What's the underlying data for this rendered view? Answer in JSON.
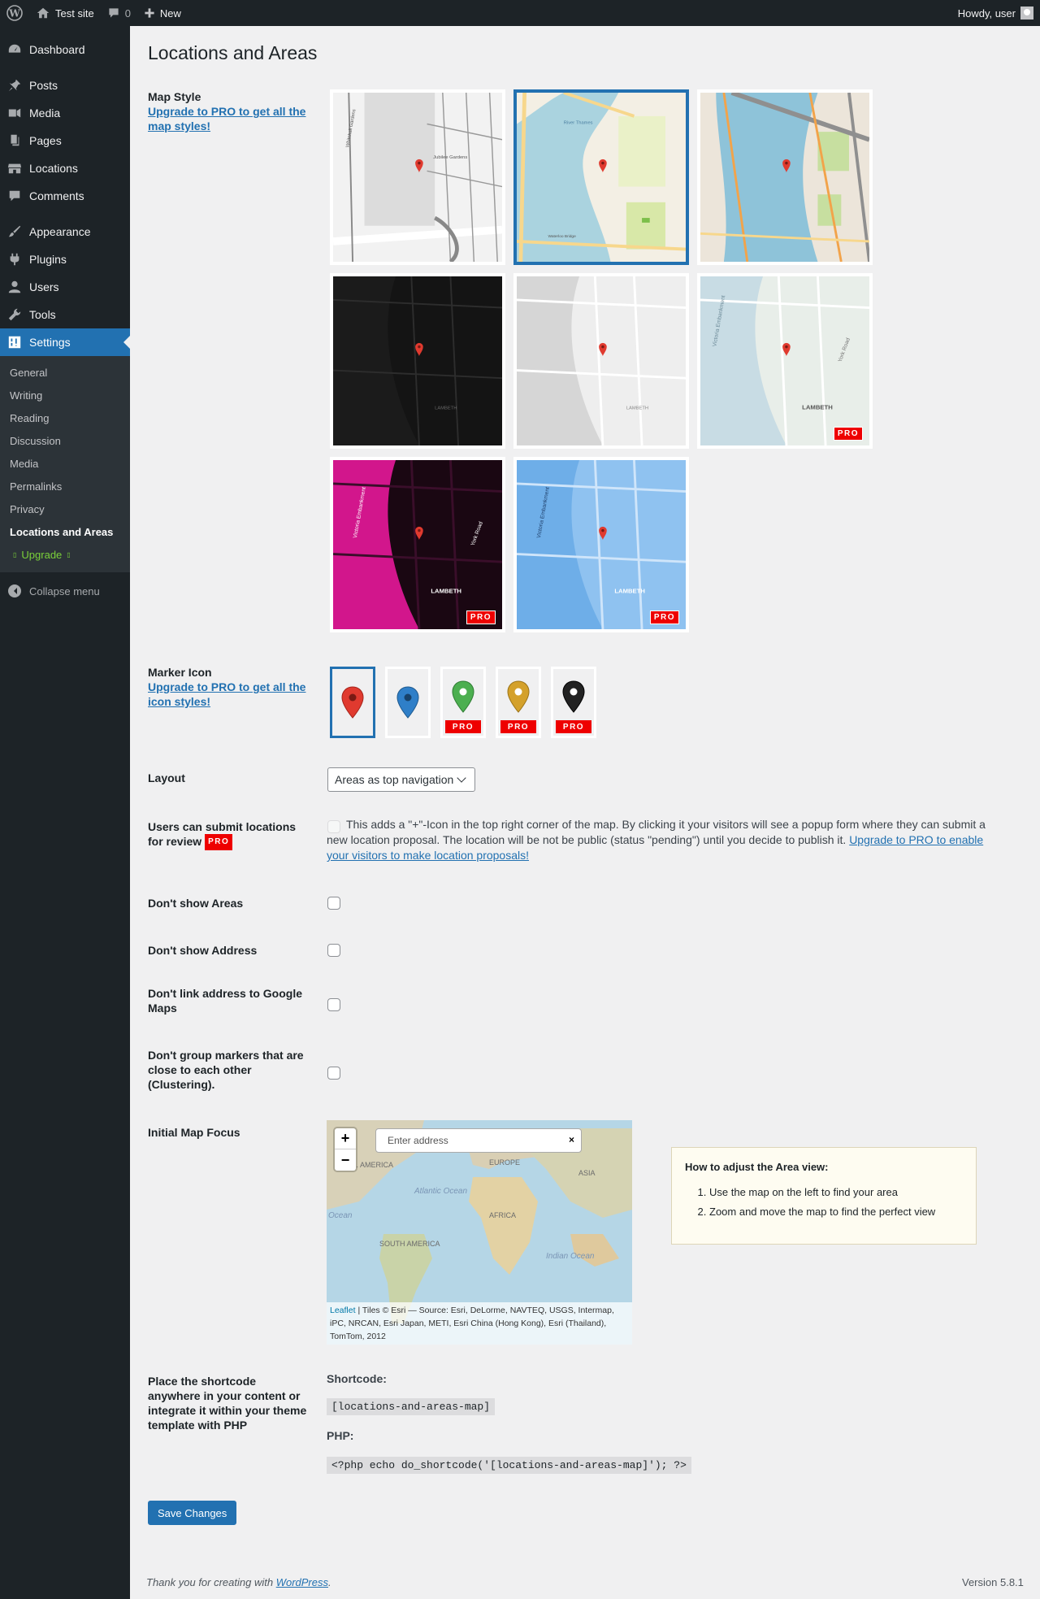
{
  "adminbar": {
    "site_name": "Test site",
    "comments_count": "0",
    "new_label": "New",
    "howdy": "Howdy, user"
  },
  "sidebar": {
    "items": [
      {
        "label": "Dashboard",
        "icon": "dashboard-icon"
      },
      {
        "label": "Posts",
        "icon": "pin-icon"
      },
      {
        "label": "Media",
        "icon": "media-icon"
      },
      {
        "label": "Pages",
        "icon": "pages-icon"
      },
      {
        "label": "Locations",
        "icon": "store-icon"
      },
      {
        "label": "Comments",
        "icon": "comment-icon"
      },
      {
        "label": "Appearance",
        "icon": "brush-icon"
      },
      {
        "label": "Plugins",
        "icon": "plugin-icon"
      },
      {
        "label": "Users",
        "icon": "user-icon"
      },
      {
        "label": "Tools",
        "icon": "wrench-icon"
      },
      {
        "label": "Settings",
        "icon": "settings-icon"
      }
    ],
    "submenu": [
      "General",
      "Writing",
      "Reading",
      "Discussion",
      "Media",
      "Permalinks",
      "Privacy",
      "Locations and Areas"
    ],
    "upgrade": "Upgrade",
    "collapse": "Collapse menu"
  },
  "page": {
    "title": "Locations and Areas"
  },
  "map_style": {
    "label": "Map Style",
    "upgrade_link": "Upgrade to PRO to get all the map styles!",
    "tiles": [
      {
        "name": "grayscale-light",
        "selected": false,
        "pro": false
      },
      {
        "name": "standard",
        "selected": true,
        "pro": false
      },
      {
        "name": "detailed-blue",
        "selected": false,
        "pro": false
      },
      {
        "name": "dark",
        "selected": false,
        "pro": false
      },
      {
        "name": "light-gray",
        "selected": false,
        "pro": false
      },
      {
        "name": "pastel-labeled",
        "selected": false,
        "pro": true
      },
      {
        "name": "magenta",
        "selected": false,
        "pro": true
      },
      {
        "name": "blue-print",
        "selected": false,
        "pro": true
      }
    ],
    "pro_label": "PRO",
    "tile_labels": {
      "lambeth": "LAMBETH",
      "victoria": "Victoria Embankment",
      "thames": "River Thames",
      "york": "York Road",
      "jubilee": "Jubilee Gardens",
      "waterloo": "Waterloo Bridge",
      "whitehall": "Whitehall Gardens"
    }
  },
  "marker_icon": {
    "label": "Marker Icon",
    "upgrade_link": "Upgrade to PRO to get all the icon styles!",
    "markers": [
      {
        "color": "#e03a2f",
        "pro": false,
        "selected": true
      },
      {
        "color": "#2f7fc8",
        "pro": false,
        "selected": false
      },
      {
        "color": "#4caf50",
        "pro": true,
        "selected": false
      },
      {
        "color": "#d4a12b",
        "pro": true,
        "selected": false
      },
      {
        "color": "#222222",
        "pro": true,
        "selected": false
      }
    ]
  },
  "layout": {
    "label": "Layout",
    "value": "Areas as top navigation"
  },
  "submit_locations": {
    "label": "Users can submit locations for review",
    "desc": "This adds a \"+\"-Icon in the top right corner of the map. By clicking it your visitors will see a popup form where they can submit a new location proposal. The location will be not be public (status \"pending\") until you decide to publish it.",
    "link": "Upgrade to PRO to enable your visitors to make location proposals!"
  },
  "options": {
    "hide_areas": "Don't show Areas",
    "hide_address": "Don't show Address",
    "no_google_link": "Don't link address to Google Maps",
    "no_cluster": "Don't group markers that are close to each other (Clustering)."
  },
  "map_focus": {
    "label": "Initial Map Focus",
    "search_placeholder": "Enter address",
    "zoom_in": "+",
    "zoom_out": "−",
    "close": "×",
    "attribution_link": "Leaflet",
    "attribution_text": " | Tiles © Esri — Source: Esri, DeLorme, NAVTEQ, USGS, Intermap, iPC, NRCAN, Esri Japan, METI, Esri China (Hong Kong), Esri (Thailand), TomTom, 2012",
    "map_labels": {
      "n_america": "N. AMERICA",
      "europe": "EUROPE",
      "asia": "ASIA",
      "atlantic": "Atlantic Ocean",
      "africa": "AFRICA",
      "s_america": "SOUTH AMERICA",
      "indian": "Indian Ocean",
      "ocean": "Ocean"
    },
    "help_title": "How to adjust the Area view:",
    "help_steps": [
      "Use the map on the left to find your area",
      "Zoom and move the map to find the perfect view"
    ]
  },
  "shortcode": {
    "label": "Place the shortcode anywhere in your content or integrate it within your theme template with PHP",
    "shortcode_label": "Shortcode:",
    "shortcode_value": "[locations-and-areas-map]",
    "php_label": "PHP:",
    "php_value": "<?php echo do_shortcode('[locations-and-areas-map]'); ?>"
  },
  "save_button": "Save Changes",
  "footer": {
    "thanks": "Thank you for creating with ",
    "wp_link": "WordPress",
    "period": ".",
    "version": "Version 5.8.1"
  }
}
